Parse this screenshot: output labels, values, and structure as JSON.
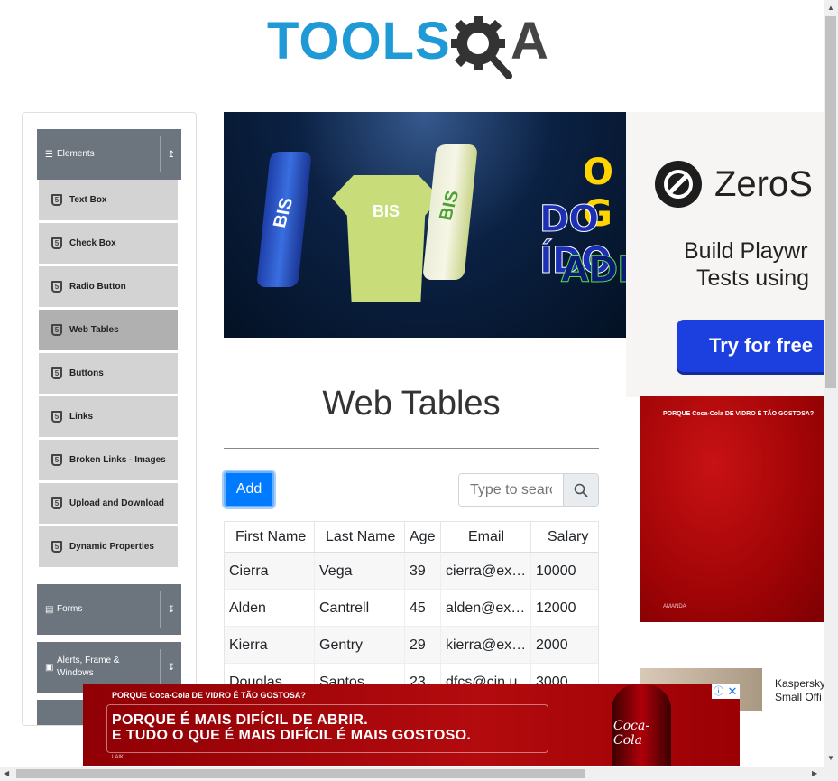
{
  "logo": {
    "left_text": "TOOLS",
    "right_text": "A"
  },
  "sidebar": {
    "groups": [
      {
        "label": "Elements",
        "icon": "hamburger-icon",
        "arrow": "collapse-icon"
      },
      {
        "label": "Forms",
        "icon": "document-icon",
        "arrow": "expand-icon"
      },
      {
        "label": "Alerts, Frame & Windows",
        "icon": "window-icon",
        "arrow": "expand-icon"
      }
    ],
    "items": [
      {
        "label": "Text Box"
      },
      {
        "label": "Check Box"
      },
      {
        "label": "Radio Button"
      },
      {
        "label": "Web Tables",
        "active": true
      },
      {
        "label": "Buttons"
      },
      {
        "label": "Links"
      },
      {
        "label": "Broken Links - Images"
      },
      {
        "label": "Upload and Download"
      },
      {
        "label": "Dynamic Properties"
      }
    ]
  },
  "banner": {
    "line1": "O G",
    "line2": "DO ÍDO",
    "line3": "ADEU",
    "can_text": "BIS",
    "shirt_text": "BIS"
  },
  "main": {
    "title": "Web Tables",
    "add_label": "Add",
    "search": {
      "placeholder": "Type to search",
      "value": ""
    }
  },
  "table": {
    "headers": [
      "First Name",
      "Last Name",
      "Age",
      "Email",
      "Salary"
    ],
    "rows": [
      [
        "Cierra",
        "Vega",
        "39",
        "cierra@ex…",
        "10000"
      ],
      [
        "Alden",
        "Cantrell",
        "45",
        "alden@ex…",
        "12000"
      ],
      [
        "Kierra",
        "Gentry",
        "29",
        "kierra@ex…",
        "2000"
      ],
      [
        "Douglas",
        "Santos",
        "23",
        "dfcs@cin.u…",
        "3000"
      ]
    ]
  },
  "ads": {
    "right_brand": "ZeroS",
    "right_tag1": "Build Playwr",
    "right_tag2": "Tests using",
    "right_cta": "Try for free",
    "coke_caption": "PORQUE Coca-Cola DE VIDRO É TÃO GOSTOSA?",
    "coke_footer": "AMANDA",
    "kasp_line1": "Kaspersky",
    "kasp_line2": "Small Offi",
    "bottom_caption": "PORQUE Coca-Cola DE VIDRO É TÃO GOSTOSA?",
    "bottom_line1": "PORQUE É MAIS DIFÍCIL DE ABRIR.",
    "bottom_line2": "E TUDO O QUE É MAIS DIFÍCIL É MAIS GOSTOSO.",
    "bottom_bottle_text": "Coca-Cola",
    "bottom_footer": "LAIK"
  },
  "colors": {
    "accent": "#007bff",
    "logo_blue": "#1f9ad6",
    "sidebar_header": "#6c757d",
    "coke_red": "#b30b0e"
  }
}
